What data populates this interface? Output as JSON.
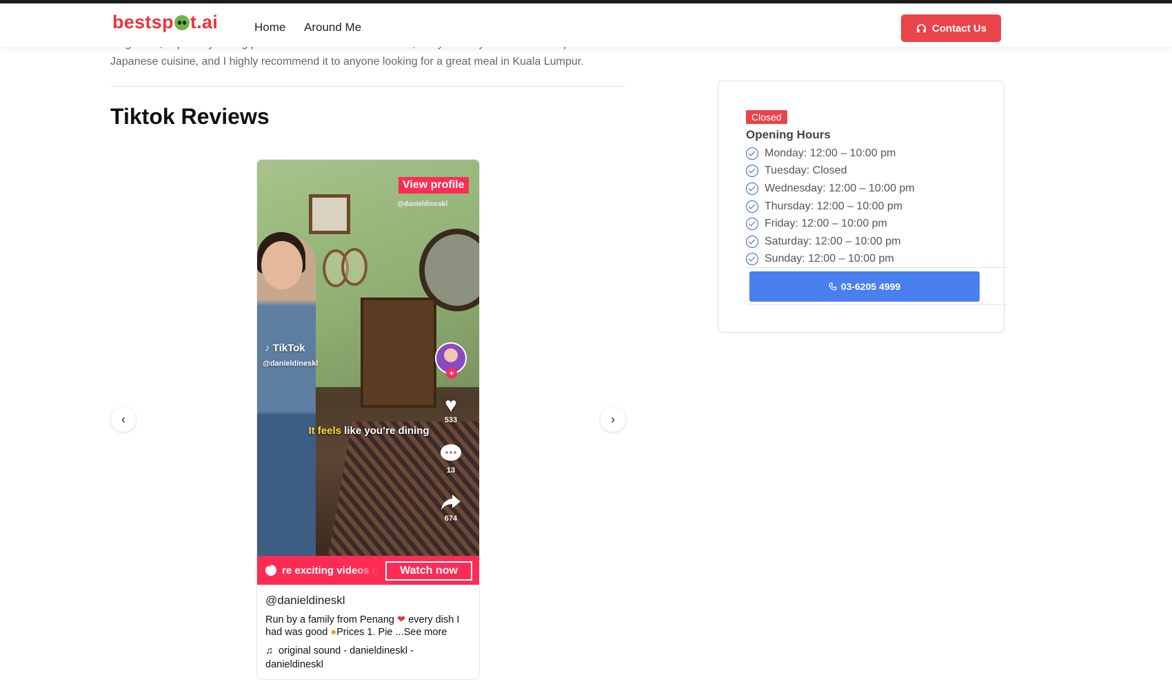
{
  "header": {
    "logo": "bestsp",
    "logo_suffix": "t.ai",
    "nav": [
      "Home",
      "Around Me"
    ],
    "contact_label": "Contact Us"
  },
  "intro": {
    "text": "long waits, especially during peak hours or weekends. Overall, Senya Izakaya is a fantastic spot for Japanese cuisine, and I highly recommend it to anyone looking for a great meal in Kuala Lumpur."
  },
  "tiktok": {
    "section_title": "Tiktok Reviews",
    "view_profile": "View profile",
    "overlay_handle": "@danieldineskl",
    "tiktok_logo": "TikTok",
    "tiktok_handle": "@danieldineskl",
    "likes": "533",
    "comments": "13",
    "shares": "674",
    "caption_highlight": "It feels",
    "caption_rest": "like you’re dining",
    "promo_text": "re exciting videos o",
    "watch_now": "Watch now",
    "handle": "@danieldineskl",
    "description_1": "Run by a family from Penang ",
    "description_2": " every dish I had was good ",
    "description_3": "Prices  1. Pie ",
    "see_more": "...See more",
    "sound": "original sound - danieldineskl - danieldineskl"
  },
  "hours": {
    "status": "Closed",
    "title": "Opening Hours",
    "days": [
      "Monday: 12:00 – 10:00 pm",
      "Tuesday: Closed",
      "Wednesday: 12:00 – 10:00 pm",
      "Thursday: 12:00 – 10:00 pm",
      "Friday: 12:00 – 10:00 pm",
      "Saturday: 12:00 – 10:00 pm",
      "Sunday: 12:00 – 10:00 pm"
    ],
    "phone": "03-6205 4999"
  },
  "colors": {
    "brand": "#e8363c",
    "tiktok_pink": "#fe2c55",
    "phone_button": "#4a7ff0",
    "check": "#3b5ccc"
  },
  "icons": {
    "contact": "headset-icon",
    "prev": "chevron-left-icon",
    "next": "chevron-right-icon",
    "phone": "phone-icon",
    "check": "check-circle-icon"
  }
}
